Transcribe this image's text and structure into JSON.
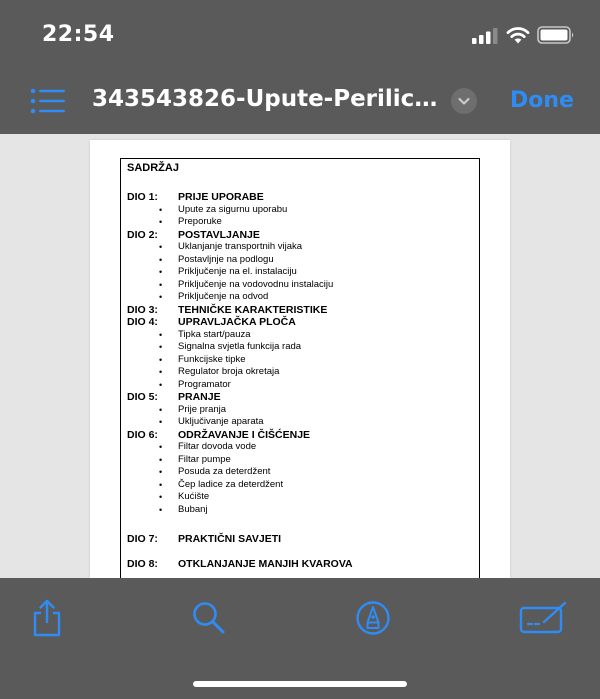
{
  "status_bar": {
    "time": "22:54"
  },
  "nav": {
    "title": "343543826-Upute-Perilice...",
    "done_label": "Done"
  },
  "document": {
    "heading": "SADRŽAJ",
    "sections": [
      {
        "dio": "DIO 1:",
        "title": "PRIJE UPORABE",
        "items": [
          "Upute za sigurnu uporabu",
          "Preporuke"
        ]
      },
      {
        "dio": "DIO 2:",
        "title": "POSTAVLJANJE",
        "items": [
          "Uklanjanje transportnih vijaka",
          "Postavljnje na podlogu",
          "Priključenje na el. instalaciju",
          "Priključenje na vodovodnu  instalaciju",
          "Priključenje na odvod"
        ]
      },
      {
        "dio": "DIO 3:",
        "title": "TEHNIČKE KARAKTERISTIKE",
        "items": []
      },
      {
        "dio": "DIO 4:",
        "title": "UPRAVLJAČKA PLOČA",
        "items": [
          "Tipka start/pauza",
          "Signalna svjetla funkcija rada",
          "Funkcijske tipke",
          "Regulator broja okretaja",
          "Programator"
        ]
      },
      {
        "dio": "DIO 5:",
        "title": "PRANJE",
        "items": [
          "Prije pranja",
          "Uključivanje aparata"
        ]
      },
      {
        "dio": "DIO 6:",
        "title": "ODRŽAVANJE I ČIŠĆENJE",
        "items": [
          "Filtar dovoda vode",
          "Filtar pumpe",
          "Posuda za deterdžent",
          "Čep ladice za deterdžent",
          "Kućište",
          "Bubanj"
        ]
      },
      {
        "dio": "DIO 7:",
        "title": "PRAKTIČNI SAVJETI",
        "items": []
      },
      {
        "dio": "DIO  8:",
        "title": "OTKLANJANJE MANJIH KVAROVA",
        "items": []
      }
    ]
  },
  "toolbar": {
    "icons": [
      "share-icon",
      "search-icon",
      "markup-icon",
      "signature-icon"
    ]
  },
  "colors": {
    "accent": "#2f8cf5",
    "bar": "#5a5a5a",
    "background": "#e5e5e5"
  }
}
